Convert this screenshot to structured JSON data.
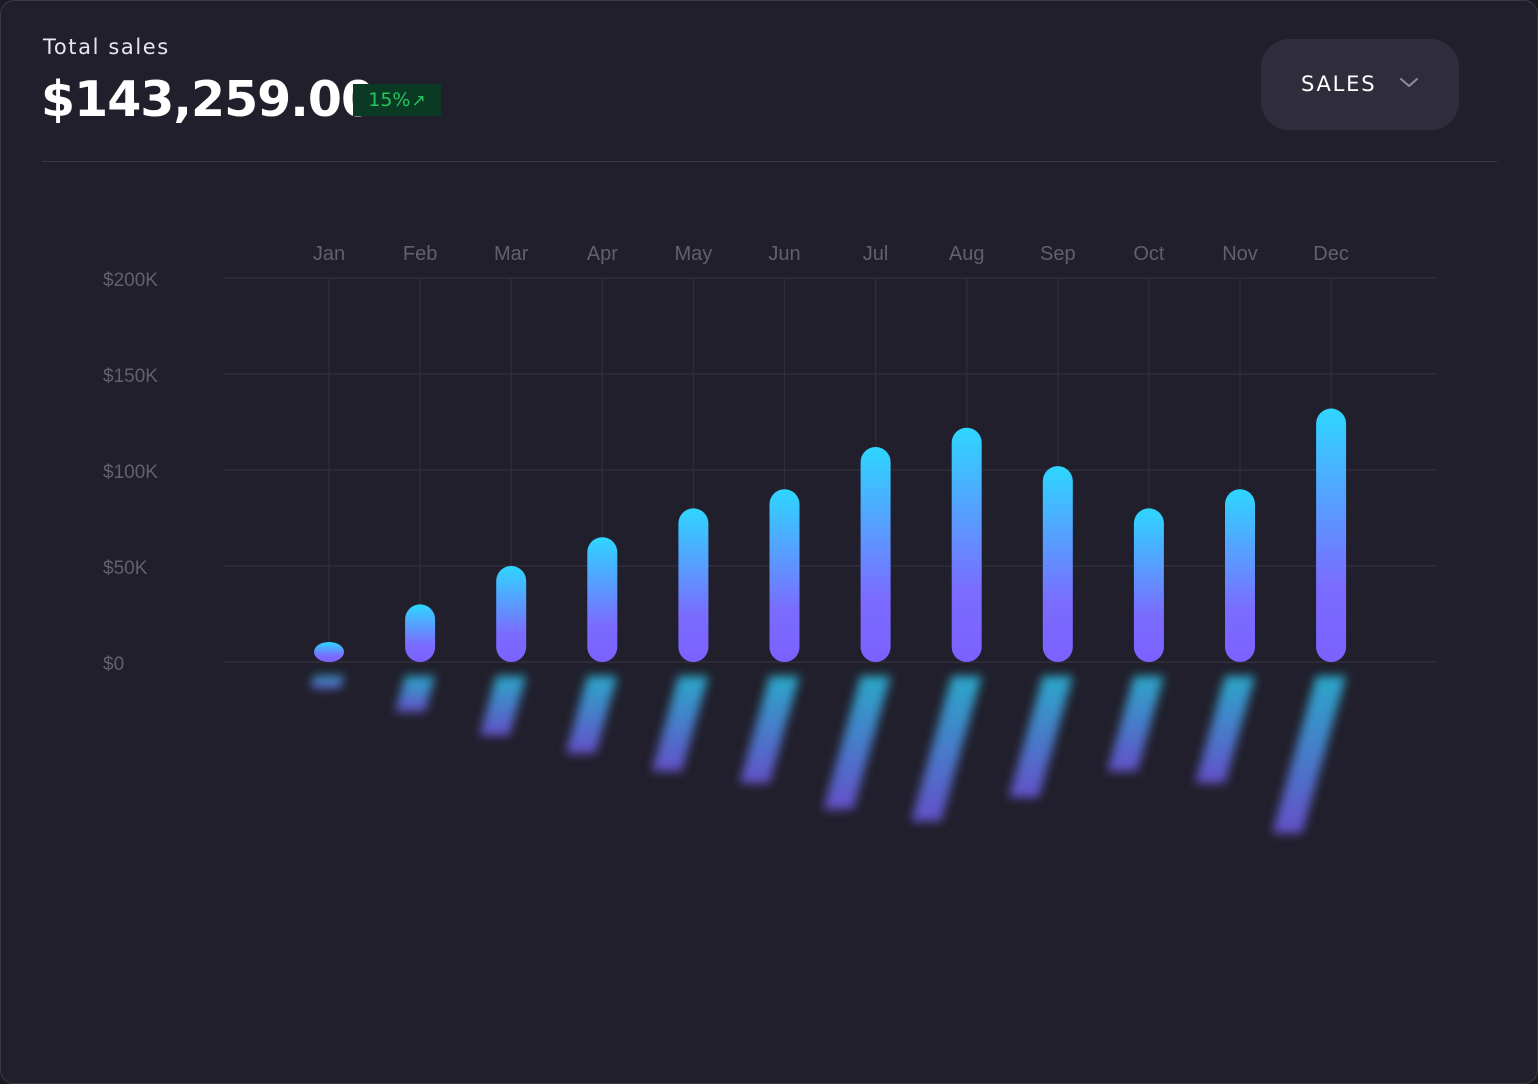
{
  "header": {
    "title": "Total sales",
    "amount": "$143,259.00",
    "badge_text": "15%",
    "badge_icon": "arrow-up-right-icon",
    "dropdown_label": "SALES",
    "dropdown_icon": "chevron-down-icon"
  },
  "colors": {
    "background": "#211f2b",
    "bar_top": "#2ed6ff",
    "bar_bottom": "#7b61ff",
    "badge_bg": "#0b3a24",
    "badge_text": "#22c55e"
  },
  "chart_data": {
    "type": "bar",
    "categories": [
      "Jan",
      "Feb",
      "Mar",
      "Apr",
      "May",
      "Jun",
      "Jul",
      "Aug",
      "Sep",
      "Oct",
      "Nov",
      "Dec"
    ],
    "values": [
      10000,
      30000,
      50000,
      65000,
      80000,
      90000,
      112000,
      122000,
      102000,
      80000,
      90000,
      132000
    ],
    "ylim": [
      0,
      200000
    ],
    "yticks": [
      0,
      50000,
      100000,
      150000,
      200000
    ],
    "ytick_labels": [
      "$0",
      "$50K",
      "$100K",
      "$150K",
      "$200K"
    ],
    "grid": true,
    "xlabel": "",
    "ylabel": "",
    "title": ""
  }
}
